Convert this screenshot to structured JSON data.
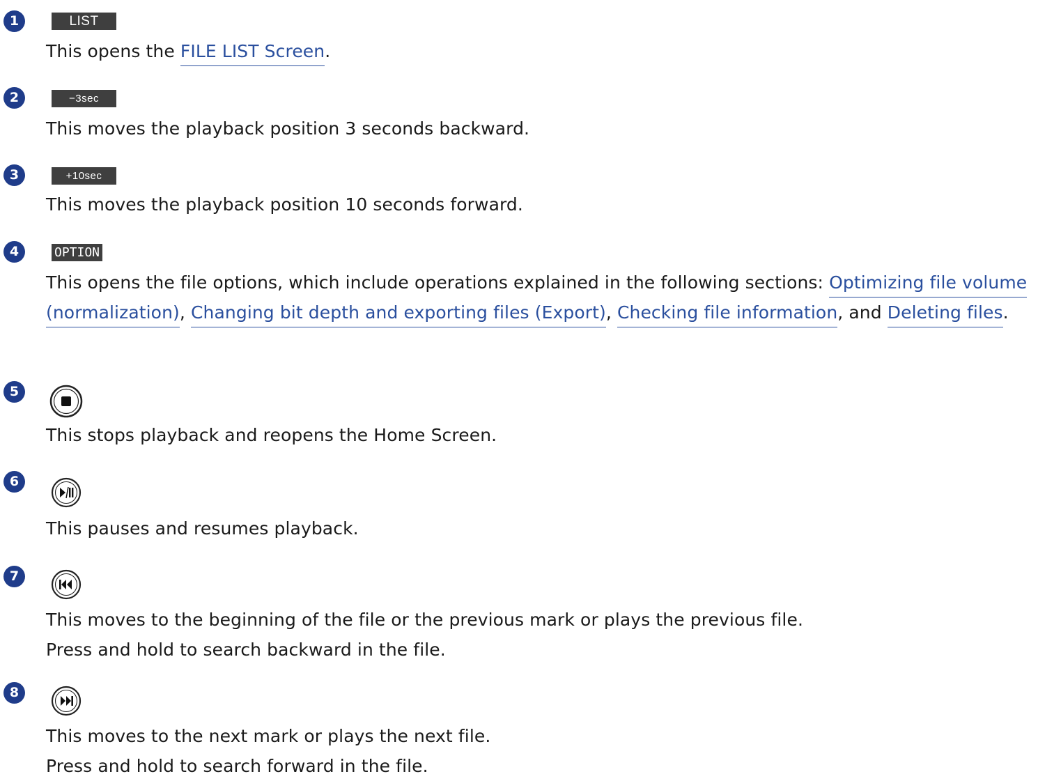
{
  "items": [
    {
      "number": "1",
      "label": "LIST",
      "desc_pre": "This opens the ",
      "link": "FILE LIST Screen",
      "desc_post": "."
    },
    {
      "number": "2",
      "label": "−3sec",
      "desc": "This moves the playback position 3 seconds backward."
    },
    {
      "number": "3",
      "label": "+10sec",
      "desc": "This moves the playback position 10 seconds forward."
    },
    {
      "number": "4",
      "label": "OPTION",
      "desc_pre": "This opens the file options, which include operations explained in the following sections: ",
      "link1": "Optimizing file volume (normalization)",
      "sep1": ", ",
      "link2": "Changing bit depth and exporting files (Export)",
      "sep2": ", ",
      "link3": "Checking file information",
      "sep3": ", and ",
      "link4": "Deleting files",
      "desc_post": "."
    },
    {
      "number": "5",
      "icon": "stop-icon",
      "desc": "This stops playback and reopens the Home Screen."
    },
    {
      "number": "6",
      "icon": "play-pause-icon",
      "desc": "This pauses and resumes playback."
    },
    {
      "number": "7",
      "icon": "skip-back-icon",
      "line1": "This moves to the beginning of the file or the previous mark or plays the previous file.",
      "line2": "Press and hold to search backward in the file."
    },
    {
      "number": "8",
      "icon": "skip-forward-icon",
      "line1": "This moves to the next mark or plays the next file.",
      "line2": "Press and hold to search forward in the file."
    }
  ],
  "colors": {
    "number_badge": "#1f3c8a",
    "label_bg": "#3f3f3f",
    "link": "#2a4f9e"
  }
}
